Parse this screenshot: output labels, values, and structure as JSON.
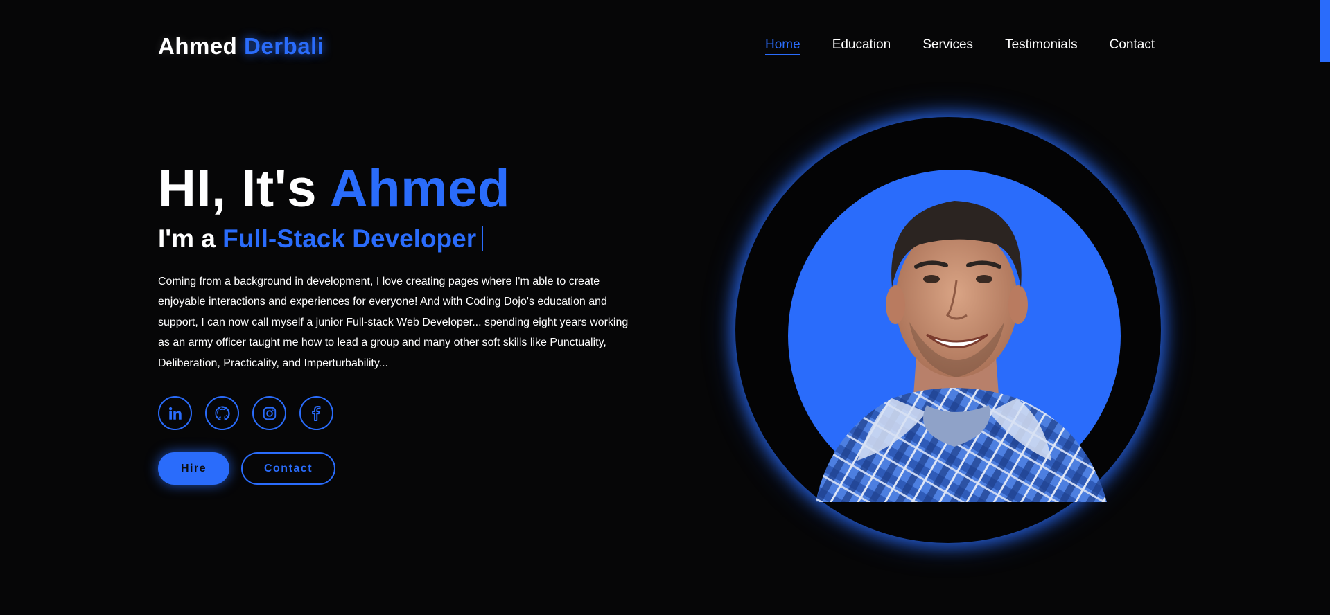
{
  "header": {
    "logo_first": "Ahmed",
    "logo_last": "Derbali",
    "nav": [
      {
        "label": "Home",
        "active": true
      },
      {
        "label": "Education",
        "active": false
      },
      {
        "label": "Services",
        "active": false
      },
      {
        "label": "Testimonials",
        "active": false
      },
      {
        "label": "Contact",
        "active": false
      }
    ]
  },
  "hero": {
    "greeting_prefix": "HI, It's",
    "greeting_name": "Ahmed",
    "role_prefix": "I'm a",
    "role_title": "Full-Stack Developer",
    "intro": "Coming from a background in development, I love creating pages where I'm able to create enjoyable interactions and experiences for everyone! And with Coding Dojo's education and support, I can now call myself a junior Full-stack Web Developer... spending eight years working as an army officer taught me how to lead a group and many other soft skills like Punctuality, Deliberation, Practicality, and Imperturbability..."
  },
  "socials": [
    {
      "icon": "linkedin-icon"
    },
    {
      "icon": "github-icon"
    },
    {
      "icon": "instagram-icon"
    },
    {
      "icon": "facebook-icon"
    }
  ],
  "buttons": {
    "hire_label": "Hire",
    "contact_label": "Contact"
  },
  "theme": {
    "accent": "#2a6cfb",
    "background": "#060607"
  }
}
